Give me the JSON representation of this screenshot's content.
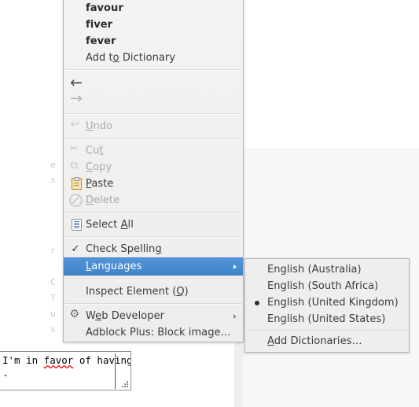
{
  "page": {
    "background_color": "#ffffff",
    "panel_color": "#f7f7f7",
    "fragments": [
      "e",
      "s",
      "r",
      "C",
      "T",
      "u",
      "s"
    ]
  },
  "textarea": {
    "line1_prefix": "I'm in ",
    "misspelled_word": "favor",
    "line1_suffix": " of having",
    "line2": ".",
    "spellcheck_underline_color": "#e00000"
  },
  "context_menu": {
    "accent_color": "#4a8cd2",
    "background_color": "#f2f1f0",
    "suggestions": [
      {
        "label": "favour",
        "name": "suggestion-favour"
      },
      {
        "label": "fiver",
        "name": "suggestion-fiver"
      },
      {
        "label": "fever",
        "name": "suggestion-fever"
      }
    ],
    "add_to_dictionary": {
      "pre": "Add t",
      "accel": "o",
      "post": " Dictionary"
    },
    "nav": {
      "back_icon": "back-arrow-icon",
      "forward_icon": "forward-arrow-icon",
      "back_glyph": "←",
      "forward_glyph": "→"
    },
    "items": [
      {
        "name": "menu-item-undo",
        "icon": "undo-icon",
        "pre": "",
        "accel": "U",
        "post": "ndo",
        "enabled": false
      },
      {
        "name": "menu-item-cut",
        "icon": "scissors-icon",
        "pre": "Cu",
        "accel": "t",
        "post": "",
        "enabled": false
      },
      {
        "name": "menu-item-copy",
        "icon": "copy-icon",
        "pre": "",
        "accel": "C",
        "post": "opy",
        "enabled": false
      },
      {
        "name": "menu-item-paste",
        "icon": "clipboard-icon",
        "pre": "",
        "accel": "P",
        "post": "aste",
        "enabled": true
      },
      {
        "name": "menu-item-delete",
        "icon": "forbidden-icon",
        "pre": "",
        "accel": "D",
        "post": "elete",
        "enabled": false
      },
      {
        "name": "menu-item-select-all",
        "icon": "document-icon",
        "pre": "Select ",
        "accel": "A",
        "post": "ll",
        "enabled": true
      },
      {
        "name": "menu-item-check-spelling",
        "icon": "checkmark-icon",
        "pre": "Check Spellin",
        "accel": "g",
        "post": "",
        "enabled": true,
        "checked": true
      },
      {
        "name": "menu-item-languages",
        "icon": "none",
        "pre": "",
        "accel": "L",
        "post": "anguages",
        "enabled": true,
        "highlighted": true,
        "has_submenu": true
      },
      {
        "name": "menu-item-inspect-element",
        "icon": "none",
        "pre": "Inspect Element (",
        "accel": "Q",
        "post": ")",
        "enabled": true
      },
      {
        "name": "menu-item-web-developer",
        "icon": "gear-icon",
        "pre": "W",
        "accel": "e",
        "post": "b Developer",
        "enabled": true,
        "has_submenu": true
      },
      {
        "name": "menu-item-adblock-plus",
        "icon": "none",
        "pre": "Adblock Plus: Block image…",
        "accel": "",
        "post": "",
        "enabled": true
      }
    ]
  },
  "languages_submenu": {
    "items": [
      {
        "name": "language-english-australia",
        "label": "English (Australia)",
        "selected": false
      },
      {
        "name": "language-english-south-africa",
        "label": "English (South Africa)",
        "selected": false
      },
      {
        "name": "language-english-united-kingdom",
        "label": "English (United Kingdom)",
        "selected": true
      },
      {
        "name": "language-english-united-states",
        "label": "English (United States)",
        "selected": false
      }
    ],
    "add_dictionaries": {
      "pre": "",
      "accel": "A",
      "post": "dd Dictionaries…"
    }
  }
}
